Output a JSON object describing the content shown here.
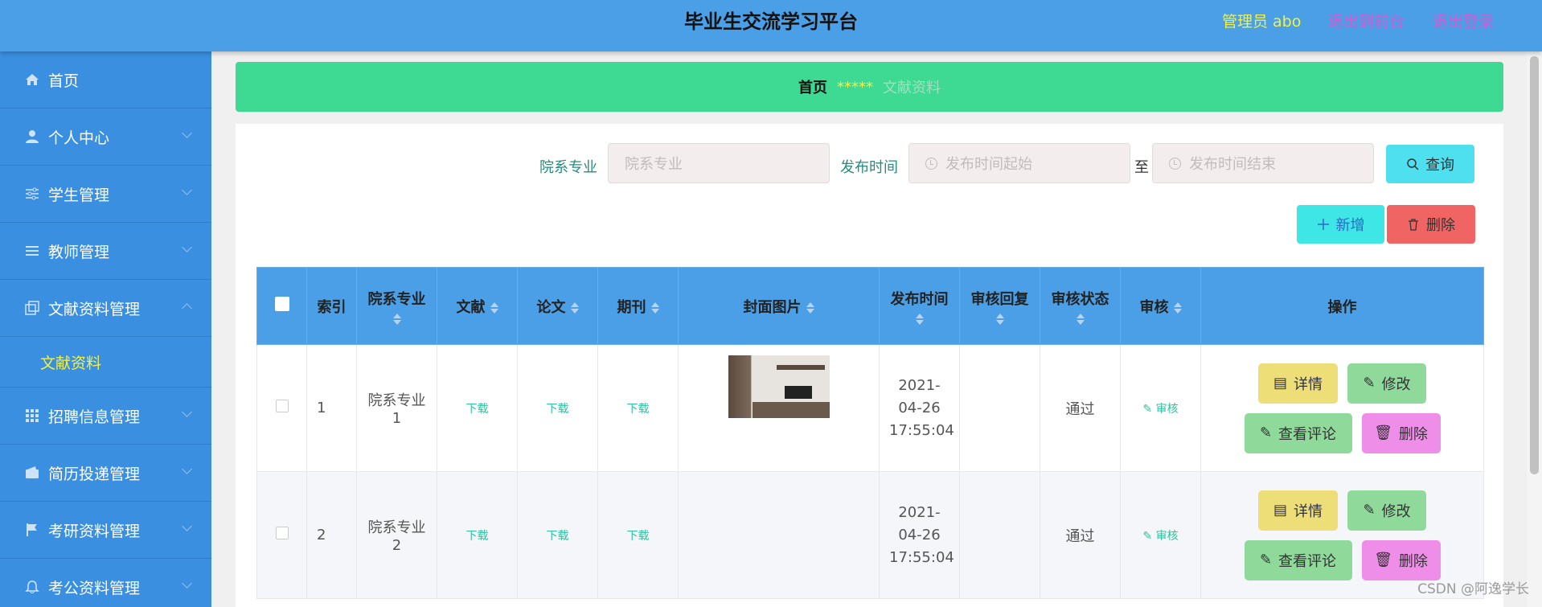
{
  "header": {
    "title": "毕业生交流学习平台",
    "admin": "管理员 abo",
    "to_front": "退出到前台",
    "logout": "退出登录"
  },
  "sidebar": {
    "items": [
      {
        "label": "首页",
        "icon": "home-icon"
      },
      {
        "label": "个人中心",
        "icon": "user-icon"
      },
      {
        "label": "学生管理",
        "icon": "sliders-icon"
      },
      {
        "label": "教师管理",
        "icon": "list-icon"
      },
      {
        "label": "文献资料管理",
        "icon": "copy-icon"
      },
      {
        "label": "招聘信息管理",
        "icon": "grid-icon"
      },
      {
        "label": "简历投递管理",
        "icon": "wallet-icon"
      },
      {
        "label": "考研资料管理",
        "icon": "flag-icon"
      },
      {
        "label": "考公资料管理",
        "icon": "bell-icon"
      }
    ],
    "subitem": "文献资料"
  },
  "breadcrumb": {
    "home": "首页",
    "separator": "*****",
    "current": "文献资料"
  },
  "search": {
    "major_label": "院系专业",
    "major_placeholder": "院系专业",
    "time_label": "发布时间",
    "time_start_placeholder": "发布时间起始",
    "to": "至",
    "time_end_placeholder": "发布时间结束",
    "query_button": "查询"
  },
  "actions": {
    "add": "新增",
    "delete": "删除"
  },
  "table": {
    "columns": [
      "索引",
      "院系专业",
      "文献",
      "论文",
      "期刊",
      "封面图片",
      "发布时间",
      "审核回复",
      "审核状态",
      "审核",
      "操作"
    ],
    "rows": [
      {
        "index": "1",
        "major": "院系专业1",
        "doc": "下载",
        "paper": "下载",
        "journal": "下载",
        "time": "2021-04-26 17:55:04",
        "reply": "",
        "status": "通过",
        "audit": "审核"
      },
      {
        "index": "2",
        "major": "院系专业2",
        "doc": "下载",
        "paper": "下载",
        "journal": "下载",
        "time": "2021-04-26 17:55:04",
        "reply": "",
        "status": "通过",
        "audit": "审核"
      }
    ],
    "ops": {
      "detail": "详情",
      "edit": "修改",
      "comment": "查看评论",
      "remove": "删除"
    }
  },
  "watermark": "CSDN @阿逸学长"
}
